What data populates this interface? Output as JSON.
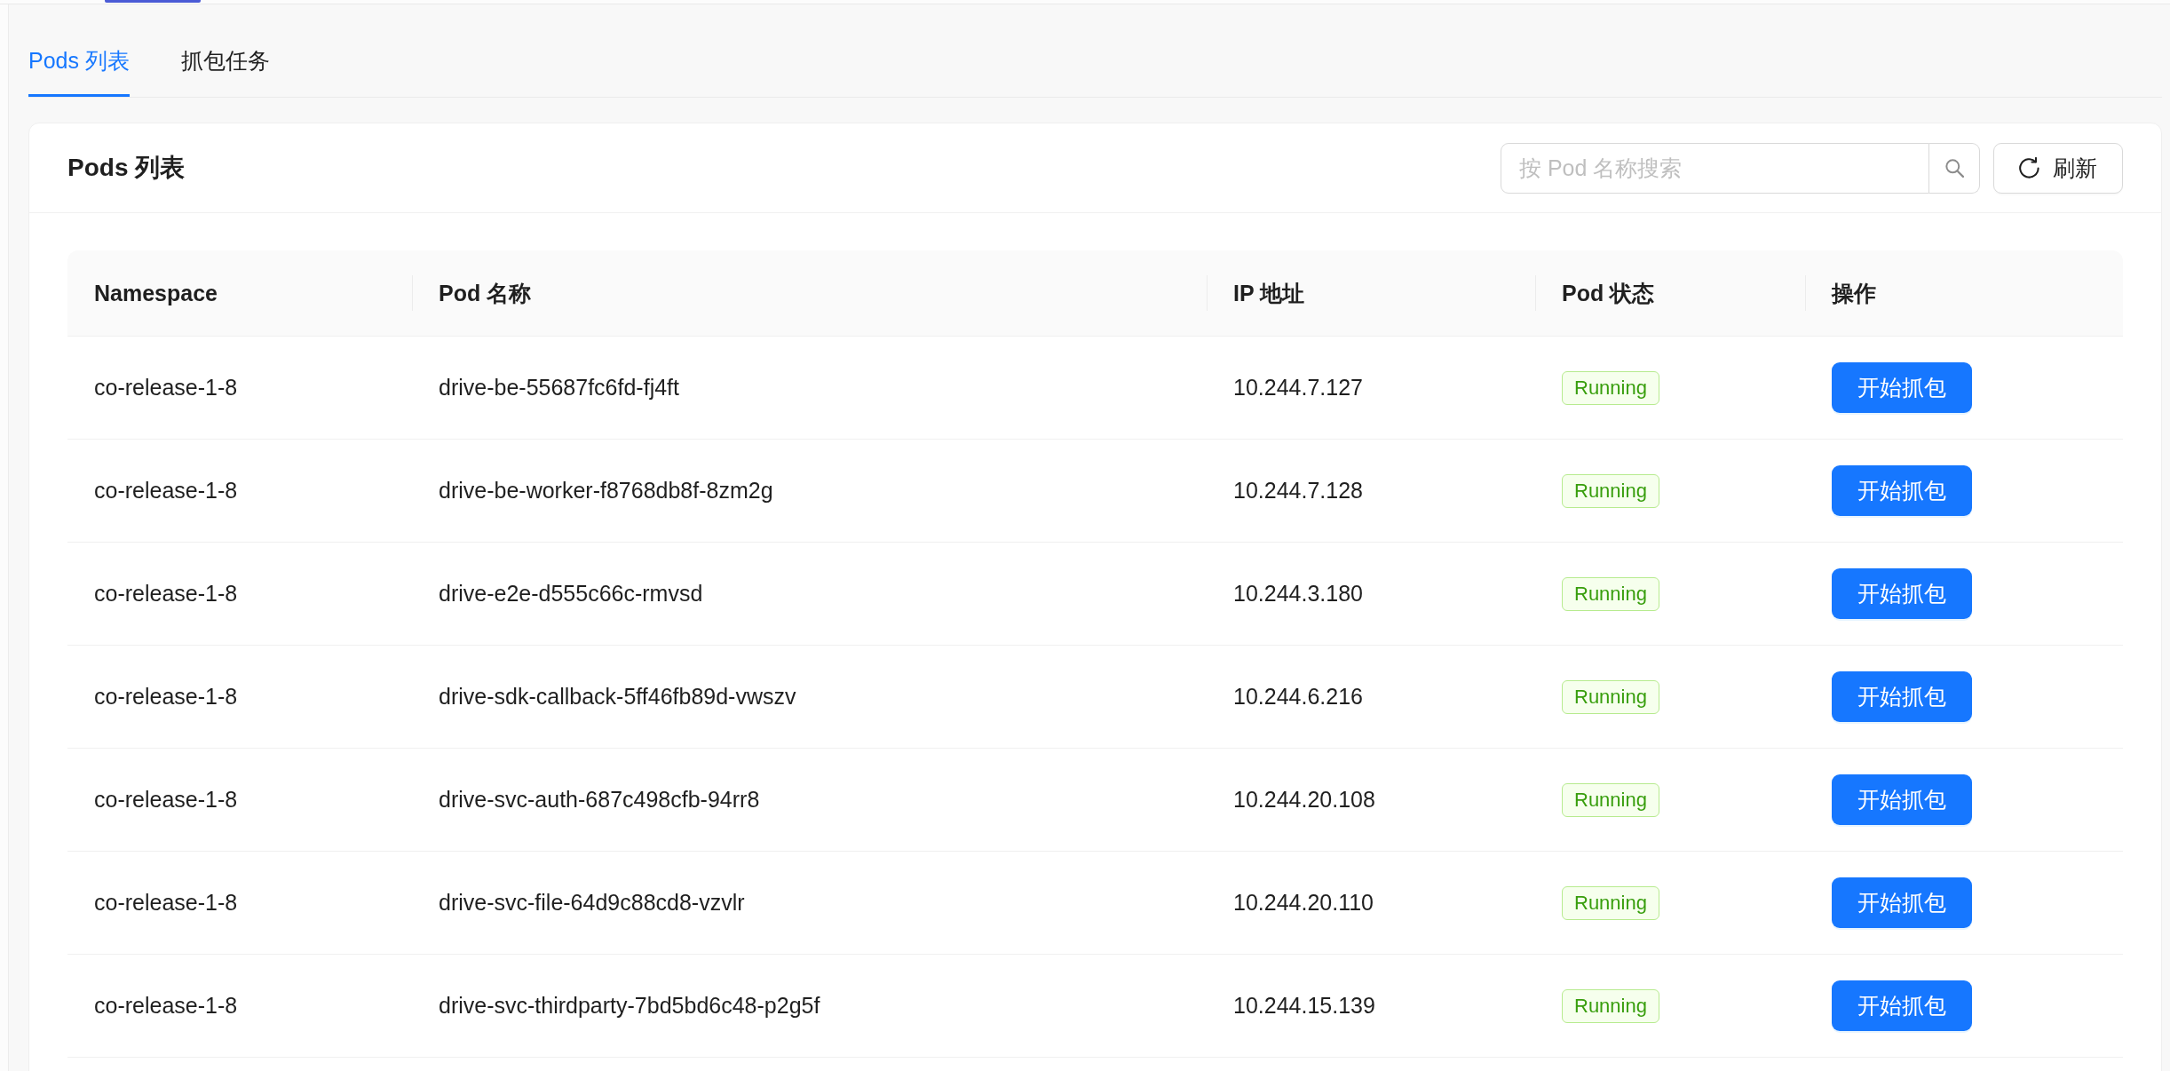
{
  "tabs": [
    {
      "label": "Pods 列表",
      "selected": true
    },
    {
      "label": "抓包任务",
      "selected": false
    }
  ],
  "card": {
    "title": "Pods 列表",
    "search": {
      "placeholder": "按 Pod 名称搜索"
    },
    "refresh_button": {
      "label": "刷新"
    }
  },
  "table": {
    "columns": [
      "Namespace",
      "Pod 名称",
      "IP 地址",
      "Pod 状态",
      "操作"
    ],
    "rows": [
      {
        "namespace": "co-release-1-8",
        "pod_name": "drive-be-55687fc6fd-fj4ft",
        "ip": "10.244.7.127",
        "status": "Running",
        "action": "开始抓包"
      },
      {
        "namespace": "co-release-1-8",
        "pod_name": "drive-be-worker-f8768db8f-8zm2g",
        "ip": "10.244.7.128",
        "status": "Running",
        "action": "开始抓包"
      },
      {
        "namespace": "co-release-1-8",
        "pod_name": "drive-e2e-d555c66c-rmvsd",
        "ip": "10.244.3.180",
        "status": "Running",
        "action": "开始抓包"
      },
      {
        "namespace": "co-release-1-8",
        "pod_name": "drive-sdk-callback-5ff46fb89d-vwszv",
        "ip": "10.244.6.216",
        "status": "Running",
        "action": "开始抓包"
      },
      {
        "namespace": "co-release-1-8",
        "pod_name": "drive-svc-auth-687c498cfb-94rr8",
        "ip": "10.244.20.108",
        "status": "Running",
        "action": "开始抓包"
      },
      {
        "namespace": "co-release-1-8",
        "pod_name": "drive-svc-file-64d9c88cd8-vzvlr",
        "ip": "10.244.20.110",
        "status": "Running",
        "action": "开始抓包"
      },
      {
        "namespace": "co-release-1-8",
        "pod_name": "drive-svc-thirdparty-7bd5bd6c48-p2g5f",
        "ip": "10.244.15.139",
        "status": "Running",
        "action": "开始抓包"
      }
    ]
  }
}
